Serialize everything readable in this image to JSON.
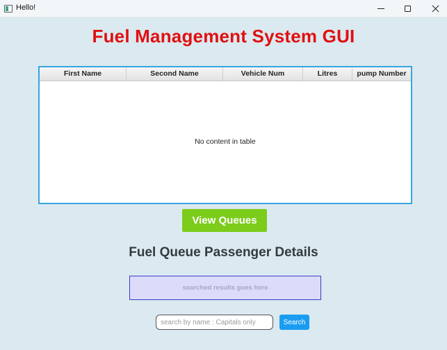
{
  "window": {
    "title": "Hello!",
    "icon": "app-window-icon",
    "controls": [
      "minimize-icon",
      "maximize-icon",
      "close-icon"
    ]
  },
  "header": {
    "title": "Fuel Management System GUI",
    "title_color": "#e01010"
  },
  "table": {
    "columns": [
      "First Name",
      "Second Name",
      "Vehicle Num",
      "Litres",
      "pump Number"
    ],
    "rows": [],
    "placeholder": "No content in table",
    "border_color": "#3aa3e0"
  },
  "actions": {
    "view_queues_label": "View Queues",
    "view_queues_color": "#7ccc1c"
  },
  "details": {
    "title": "Fuel Queue Passenger Details",
    "results_text": "searched results goes here"
  },
  "search": {
    "placeholder": "search by name : Capitals only",
    "value": "",
    "button_label": "Search",
    "button_color": "#1a9df0"
  }
}
